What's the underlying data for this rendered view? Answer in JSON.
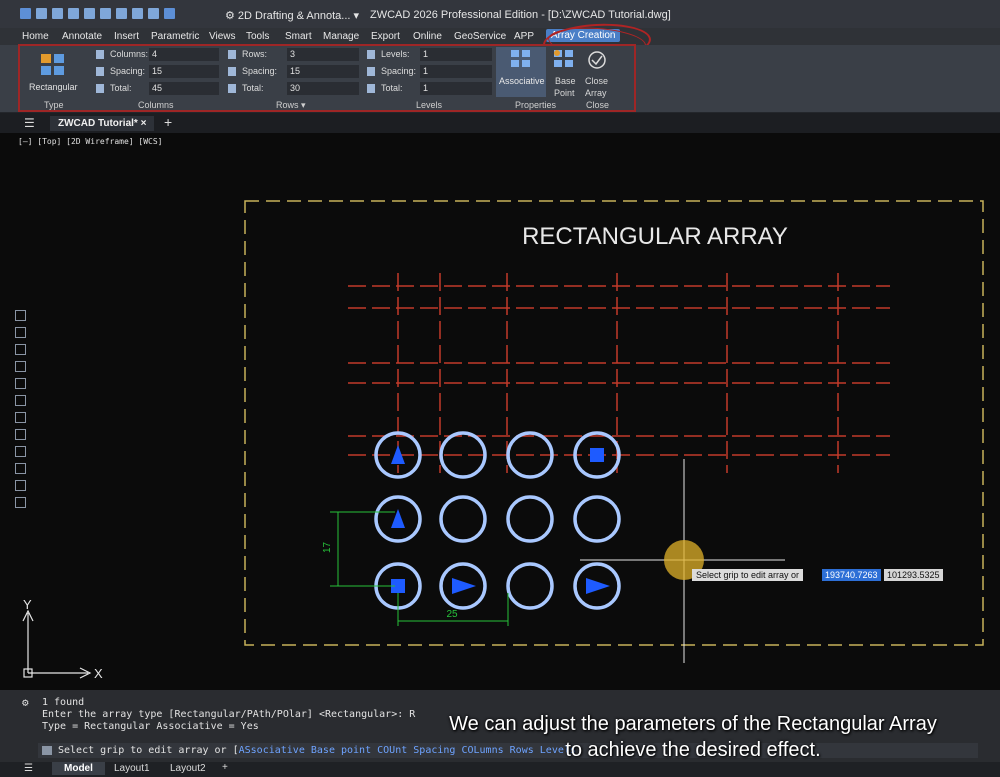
{
  "app": {
    "workspace": "2D Drafting & Annota...",
    "title": "ZWCAD 2026 Professional Edition - [D:\\ZWCAD Tutorial.dwg]"
  },
  "menu": [
    "Home",
    "Annotate",
    "Insert",
    "Parametric",
    "Views",
    "Tools",
    "Smart",
    "Manage",
    "Export",
    "Online",
    "GeoService",
    "APP",
    "Array Creation"
  ],
  "ribbon": {
    "type_button": "Rectangular",
    "columns": {
      "count_label": "Columns:",
      "count": "4",
      "spacing_label": "Spacing:",
      "spacing": "15",
      "total_label": "Total:",
      "total": "45"
    },
    "rows": {
      "count_label": "Rows:",
      "count": "3",
      "spacing_label": "Spacing:",
      "spacing": "15",
      "total_label": "Total:",
      "total": "30"
    },
    "levels": {
      "count_label": "Levels:",
      "count": "1",
      "spacing_label": "Spacing:",
      "spacing": "1",
      "total_label": "Total:",
      "total": "1"
    },
    "associative": "Associative",
    "base_point_1": "Base",
    "base_point_2": "Point",
    "close_1": "Close",
    "close_2": "Array",
    "groups": {
      "type": "Type",
      "columns": "Columns",
      "rows": "Rows ▾",
      "levels": "Levels",
      "properties": "Properties",
      "close": "Close"
    }
  },
  "doc_tab": "ZWCAD Tutorial*",
  "viewport_label": "[—] [Top] [2D Wireframe] [WCS]",
  "drawing": {
    "title": "RECTANGULAR ARRAY",
    "dim_horizontal": "25",
    "dim_vertical": "17",
    "axis_x": "X",
    "axis_y": "Y"
  },
  "tooltip": {
    "text": "Select grip to edit array or",
    "coord_x": "193740.7263",
    "coord_y": "101293.5325"
  },
  "command": {
    "line1": "1 found",
    "line2": "Enter the array type [Rectangular/PAth/POlar] <Rectangular>: R",
    "line3": "Type = Rectangular   Associative = Yes",
    "prompt_start": "Select grip to edit array or [",
    "options": [
      "ASsociative",
      "Base point",
      "COUnt",
      "Spacing",
      "COLumns",
      "Rows",
      "Levels"
    ]
  },
  "subtitle": {
    "line1": "We can adjust the parameters of the Rectangular Array",
    "line2": "to achieve the desired effect."
  },
  "layout_tabs": [
    "Model",
    "Layout1",
    "Layout2",
    "+"
  ],
  "colors": {
    "accent": "#4a7fc7",
    "annotation_red": "#b02424",
    "circle_stroke": "#a9c8ff",
    "arrow_fill": "#1e5bff",
    "dim_green": "#27c23a",
    "grid_red": "#c23a2a",
    "frame_yellow": "#c8b25a"
  }
}
